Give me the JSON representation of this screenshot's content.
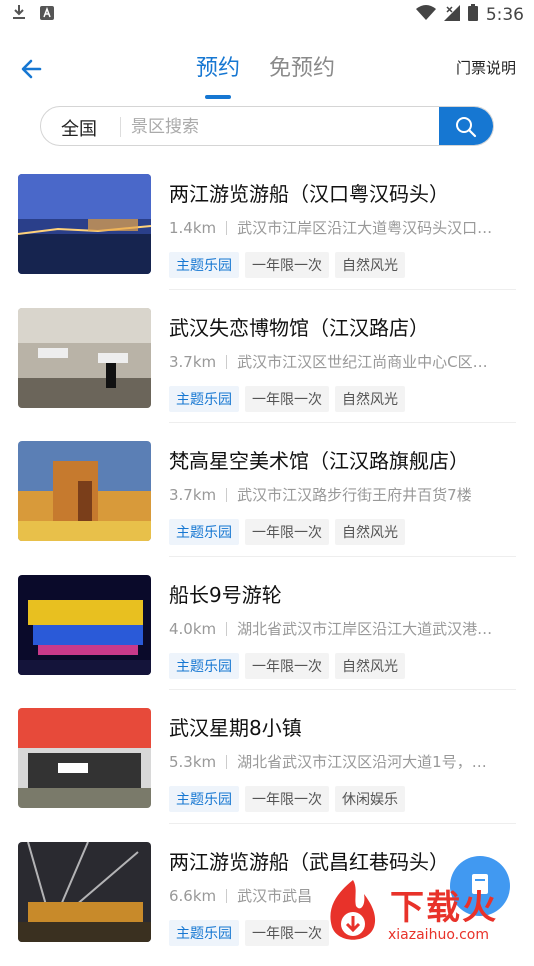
{
  "status": {
    "time": "5:36"
  },
  "header": {
    "tab_active": "预约",
    "tab_inactive": "免预约",
    "ticket_info": "门票说明"
  },
  "search": {
    "region": "全国",
    "placeholder": "景区搜索"
  },
  "items": [
    {
      "title": "两江游览游船（汉口粤汉码头）",
      "distance": "1.4km",
      "address": "武汉市江岸区沿江大道粤汉码头汉口…",
      "tags": [
        "主题乐园",
        "一年限一次",
        "自然风光"
      ]
    },
    {
      "title": "武汉失恋博物馆（江汉路店）",
      "distance": "3.7km",
      "address": "武汉市江汉区世纪江尚商业中心C区…",
      "tags": [
        "主题乐园",
        "一年限一次",
        "自然风光"
      ]
    },
    {
      "title": "梵高星空美术馆（江汉路旗舰店）",
      "distance": "3.7km",
      "address": "武汉市江汉路步行街王府井百货7楼",
      "tags": [
        "主题乐园",
        "一年限一次",
        "自然风光"
      ]
    },
    {
      "title": "船长9号游轮",
      "distance": "4.0km",
      "address": "湖北省武汉市江岸区沿江大道武汉港…",
      "tags": [
        "主题乐园",
        "一年限一次",
        "自然风光"
      ]
    },
    {
      "title": "武汉星期8小镇",
      "distance": "5.3km",
      "address": "湖北省武汉市江汉区沿河大道1号，…",
      "tags": [
        "主题乐园",
        "一年限一次",
        "休闲娱乐"
      ]
    },
    {
      "title": "两江游览游船（武昌红巷码头）",
      "distance": "6.6km",
      "address": "武汉市武昌",
      "tags": [
        "主题乐园",
        "一年限一次"
      ]
    }
  ],
  "watermark": {
    "brand": "下载火",
    "url": "xiazaihuo.com"
  },
  "colors": {
    "accent": "#1677d2",
    "watermark": "#e8322a"
  }
}
